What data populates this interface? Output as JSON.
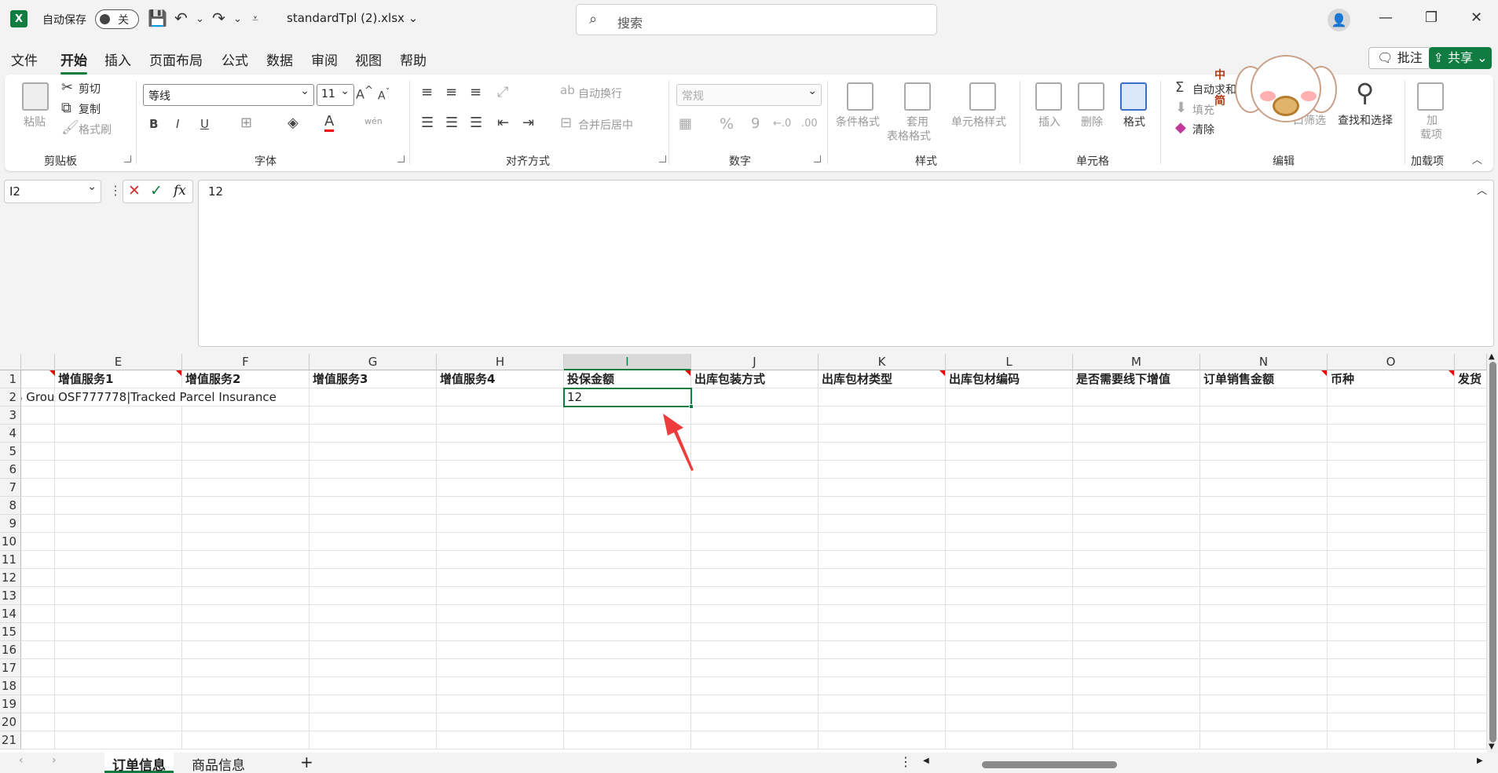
{
  "titlebar": {
    "app_icon_letter": "X",
    "autosave_label": "自动保存",
    "autosave_state": "关",
    "filename": "standardTpl (2).xlsx ⌄",
    "search_placeholder": "搜索"
  },
  "menu": {
    "items": [
      "文件",
      "开始",
      "插入",
      "页面布局",
      "公式",
      "数据",
      "审阅",
      "视图",
      "帮助"
    ],
    "active": "开始",
    "comments_label": "批注",
    "share_label": "共享"
  },
  "ribbon": {
    "clipboard": {
      "paste": "粘贴",
      "cut": "剪切",
      "copy": "复制",
      "format_painter": "格式刷",
      "group": "剪贴板"
    },
    "font": {
      "name": "等线",
      "size": "11",
      "group": "字体",
      "bold": "B",
      "italic": "I",
      "underline": "U"
    },
    "alignment": {
      "wrap": "自动换行",
      "merge": "合并后居中",
      "group": "对齐方式"
    },
    "number": {
      "format": "常规",
      "percent": "%",
      "comma": "9",
      "group": "数字"
    },
    "styles": {
      "conditional": "条件格式",
      "table_1": "套用",
      "table_2": "表格格式",
      "cell_styles": "单元格样式",
      "group": "样式"
    },
    "cells": {
      "insert": "插入",
      "delete": "删除",
      "format": "格式",
      "group": "单元格"
    },
    "editing": {
      "autosum": "自动求和",
      "fill": "填充",
      "clear": "清除",
      "sort_filter": "口筛选",
      "find": "查找和选择",
      "group": "编辑"
    },
    "addins": {
      "label_1": "加",
      "label_2": "载项",
      "group": "加载项"
    }
  },
  "formula_bar": {
    "name_box": "I2",
    "formula": "12"
  },
  "sheet": {
    "columns": [
      "E",
      "F",
      "G",
      "H",
      "I",
      "J",
      "K",
      "L",
      "M",
      "N",
      "O"
    ],
    "selected_column": "I",
    "header_row": [
      "增值服务1",
      "增值服务2",
      "增值服务3",
      "增值服务4",
      "投保金额",
      "出库包装方式",
      "出库包材类型",
      "出库包材编码",
      "是否需要线下增值",
      "订单销售金额",
      "币种"
    ],
    "partial_header": "发货",
    "row2_prefix": "S Grou",
    "row2_e": "OSF777778|Tracked Parcel Insurance",
    "row2_i": "12",
    "row_numbers": [
      "1",
      "2",
      "3",
      "4",
      "5",
      "6",
      "7",
      "8",
      "9",
      "10",
      "11",
      "12",
      "13",
      "14",
      "15",
      "16",
      "17",
      "18",
      "19",
      "20",
      "21"
    ]
  },
  "sheet_tabs": [
    "订单信息",
    "商品信息"
  ],
  "sticker_text": [
    "中",
    "简"
  ],
  "colors": {
    "excel_green": "#107c41",
    "comment_red": "#e00000",
    "arrow_red": "#ee3b3b"
  }
}
